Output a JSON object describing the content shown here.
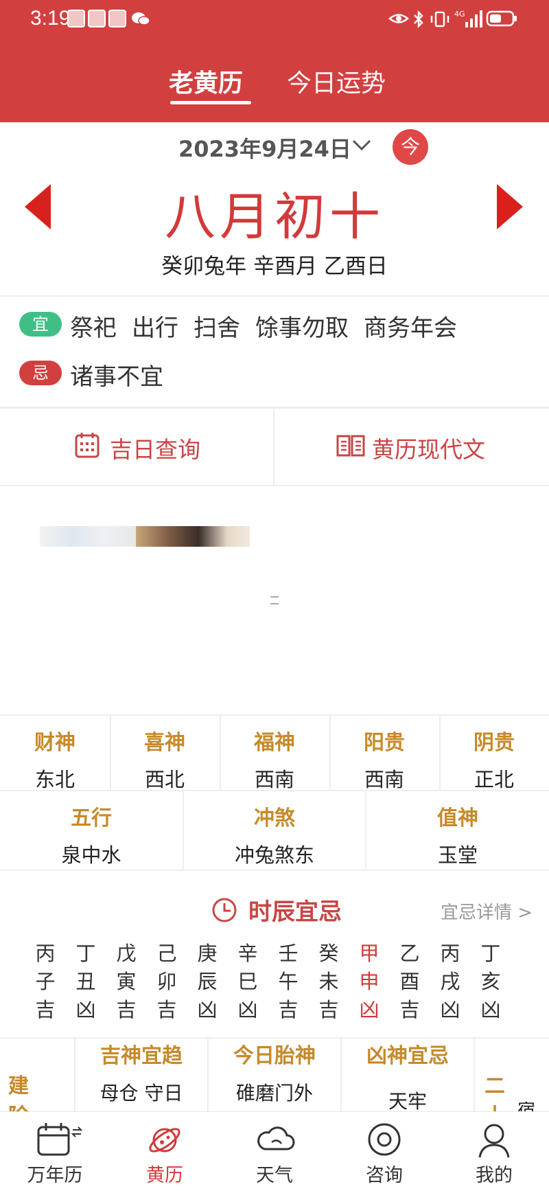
{
  "status_bar": {
    "time": "3:19",
    "network": "4G"
  },
  "tabs": {
    "active": "老黄历",
    "fortune": "今日运势"
  },
  "date": {
    "solar": "2023年9月24日",
    "today_label": "今",
    "lunar": "八月初十",
    "ganzhi": "癸卯兔年 辛酉月 乙酉日"
  },
  "yiji": {
    "yi_label": "宜",
    "yi_items": [
      "祭祀",
      "出行",
      "扫舍",
      "馀事勿取",
      "商务年会"
    ],
    "ji_label": "忌",
    "ji_items": [
      "诸事不宜"
    ],
    "yi_color": "#3fbf86",
    "ji_color": "#d23f3f"
  },
  "tools": {
    "lucky_day": "吉日查询",
    "modern_text": "黄历现代文"
  },
  "gods": [
    {
      "title": "财神",
      "value": "东北"
    },
    {
      "title": "喜神",
      "value": "西北"
    },
    {
      "title": "福神",
      "value": "西南"
    },
    {
      "title": "阳贵",
      "value": "西南"
    },
    {
      "title": "阴贵",
      "value": "正北"
    }
  ],
  "elements": [
    {
      "title": "五行",
      "value": "泉中水"
    },
    {
      "title": "冲煞",
      "value": "冲兔煞东"
    },
    {
      "title": "值神",
      "value": "玉堂"
    }
  ],
  "shichen": {
    "title": "时辰宜忌",
    "detail_link": "宜忌详情 >",
    "columns": [
      {
        "stem": "丙",
        "branch": "子",
        "luck": "吉"
      },
      {
        "stem": "丁",
        "branch": "丑",
        "luck": "凶"
      },
      {
        "stem": "戊",
        "branch": "寅",
        "luck": "吉"
      },
      {
        "stem": "己",
        "branch": "卯",
        "luck": "吉"
      },
      {
        "stem": "庚",
        "branch": "辰",
        "luck": "凶"
      },
      {
        "stem": "辛",
        "branch": "巳",
        "luck": "凶"
      },
      {
        "stem": "壬",
        "branch": "午",
        "luck": "吉"
      },
      {
        "stem": "癸",
        "branch": "未",
        "luck": "吉"
      },
      {
        "stem": "甲",
        "branch": "申",
        "luck": "凶"
      },
      {
        "stem": "乙",
        "branch": "酉",
        "luck": "吉"
      },
      {
        "stem": "丙",
        "branch": "戌",
        "luck": "凶"
      },
      {
        "stem": "丁",
        "branch": "亥",
        "luck": "凶"
      }
    ]
  },
  "cards": {
    "partial_left": "建除",
    "lucky_gods": {
      "title": "吉神宜趋",
      "value": "母仓 守日"
    },
    "fetal_god": {
      "title": "今日胎神",
      "value": "碓磨门外"
    },
    "evil_gods": {
      "title": "凶神宜忌",
      "value": "天牢"
    },
    "partial_right": "二十",
    "partial_right_extra": "宿"
  },
  "bottom_nav": [
    "万年历",
    "黄历",
    "天气",
    "咨询",
    "我的"
  ],
  "colors": {
    "brand_red": "#d23f3f",
    "gold": "#c68a2a"
  }
}
